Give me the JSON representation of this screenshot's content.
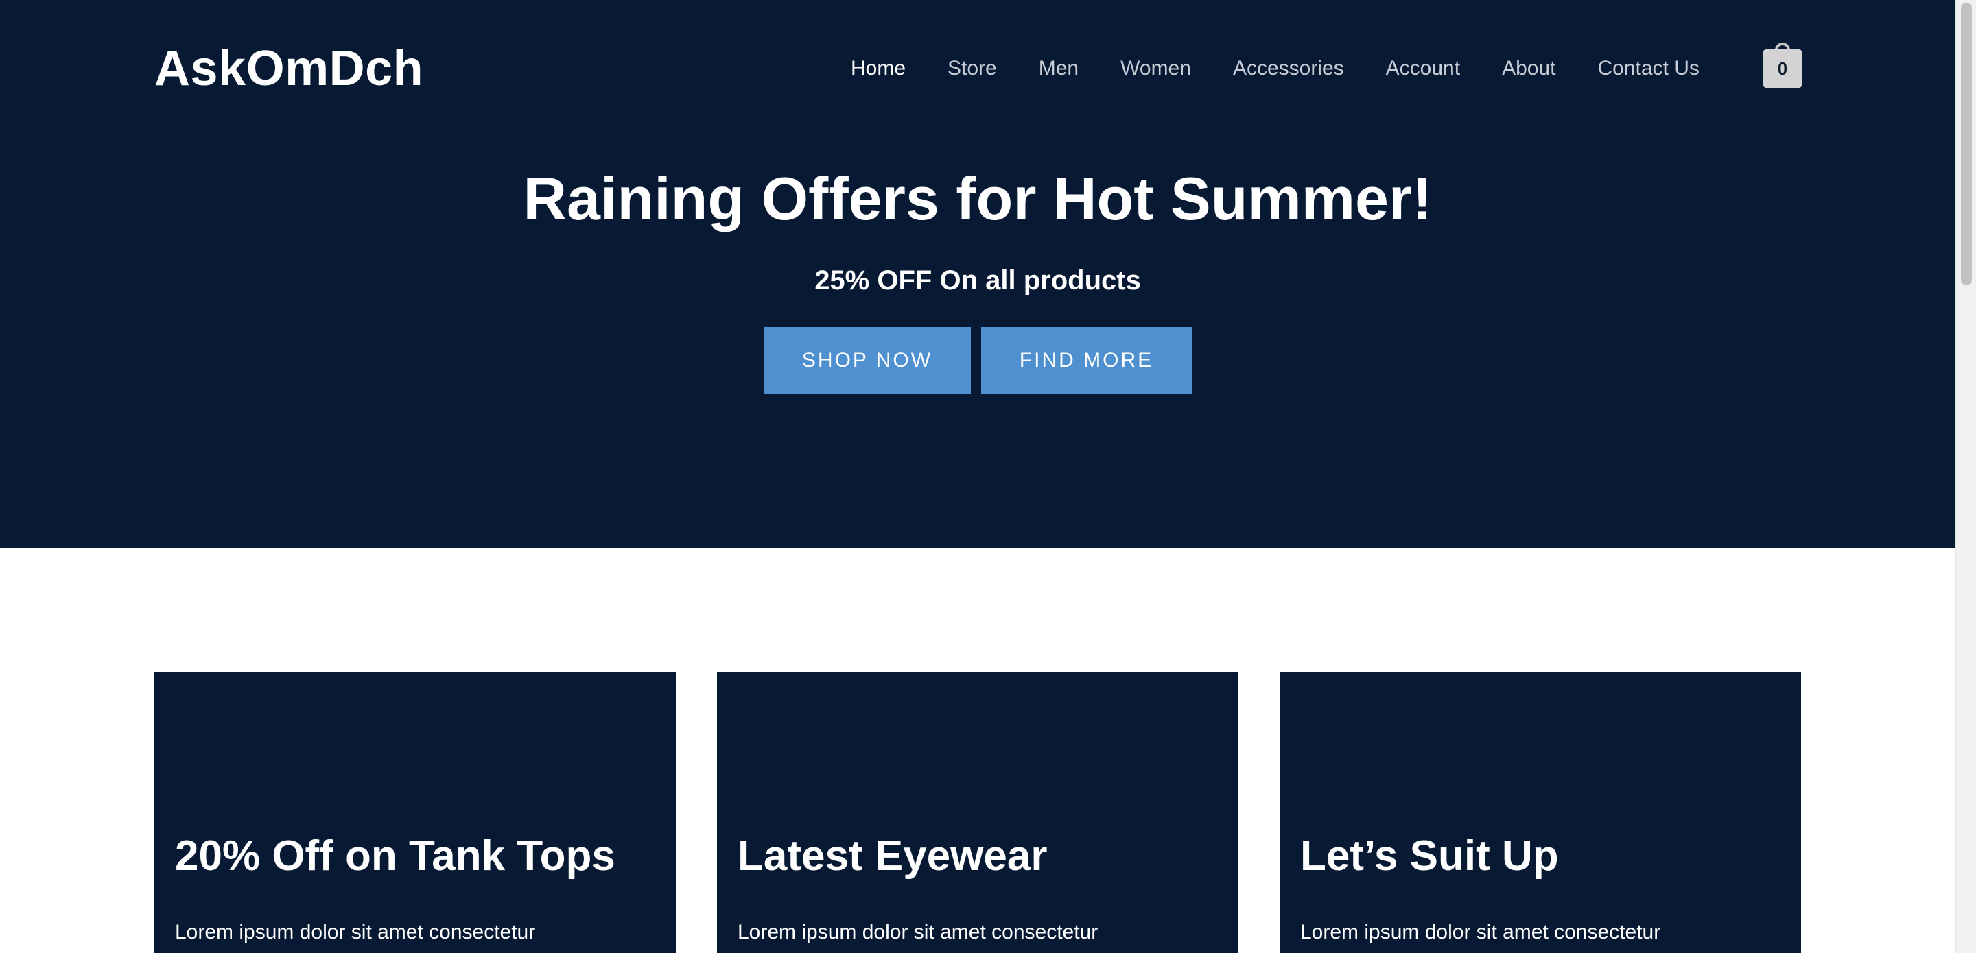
{
  "brand": {
    "logo": "AskOmDch"
  },
  "nav": {
    "items": [
      {
        "label": "Home",
        "active": true
      },
      {
        "label": "Store",
        "active": false
      },
      {
        "label": "Men",
        "active": false
      },
      {
        "label": "Women",
        "active": false
      },
      {
        "label": "Accessories",
        "active": false
      },
      {
        "label": "Account",
        "active": false
      },
      {
        "label": "About",
        "active": false
      },
      {
        "label": "Contact Us",
        "active": false
      }
    ]
  },
  "cart": {
    "count": "0",
    "icon": "shopping-bag-icon"
  },
  "hero": {
    "title": "Raining Offers for Hot Summer!",
    "subtitle": "25% OFF On all products",
    "shop_button": "SHOP NOW",
    "find_button": "FIND MORE"
  },
  "promos": [
    {
      "title": "20% Off on Tank Tops",
      "text": "Lorem ipsum dolor sit amet consectetur"
    },
    {
      "title": "Latest Eyewear",
      "text": "Lorem ipsum dolor sit amet consectetur"
    },
    {
      "title": "Let’s Suit Up",
      "text": "Lorem ipsum dolor sit amet consectetur"
    }
  ],
  "colors": {
    "hero_bg": "#081a33",
    "button_bg": "#4e90d0",
    "page_bg": "#ffffff"
  }
}
